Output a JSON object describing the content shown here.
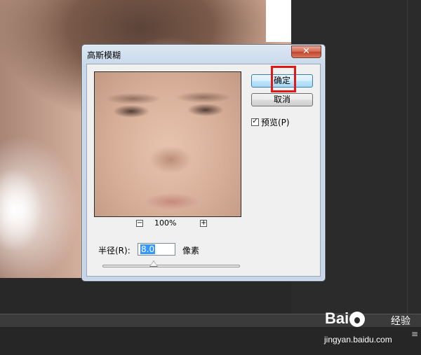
{
  "dialog": {
    "title": "高斯模糊",
    "close_symbol": "✕",
    "ok_label": "确定",
    "cancel_label": "取消",
    "preview_label": "预览(P)",
    "preview_checked": true,
    "zoom": {
      "minus": "−",
      "plus": "+",
      "value": "100%"
    },
    "radius": {
      "label": "半径(R):",
      "value": "8.0",
      "unit": "像素",
      "slider_level": 0.37
    }
  },
  "watermark": {
    "logo_prefix": "Bai",
    "logo_suffix": "",
    "cn_text": "经验",
    "url": "jingyan.baidu.com"
  },
  "colors": {
    "highlight": "#e01818",
    "ok_border": "#3c7fb1",
    "selection": "#3399ff"
  },
  "icons": [
    "close-icon",
    "zoom-out-icon",
    "zoom-in-icon",
    "checkbox-checked-icon",
    "panel-menu-icon",
    "baidu-paw-icon"
  ]
}
